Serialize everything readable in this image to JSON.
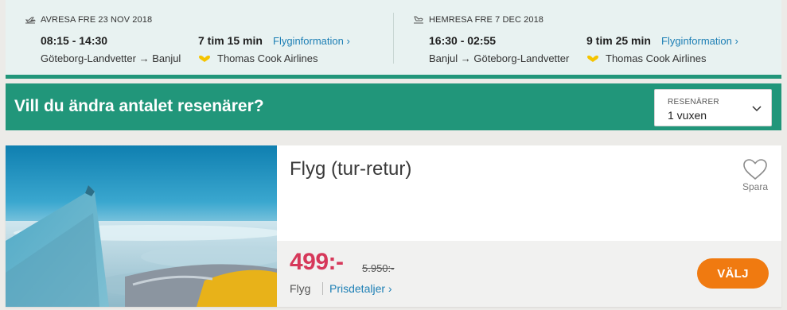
{
  "outbound": {
    "header": "AVRESA FRE 23 NOV 2018",
    "times": "08:15 - 14:30",
    "route": "Göteborg-Landvetter → Banjul",
    "duration": "7 tim 15 min",
    "info_link": "Flyginformation ›",
    "airline": "Thomas Cook Airlines"
  },
  "return": {
    "header": "HEMRESA FRE 7 DEC 2018",
    "times": "16:30 - 02:55",
    "route": "Banjul → Göteborg-Landvetter",
    "duration": "9 tim 25 min",
    "info_link": "Flyginformation ›",
    "airline": "Thomas Cook Airlines"
  },
  "travelers_banner": {
    "title": "Vill du ändra antalet resenärer?",
    "select_label": "RESENÄRER",
    "select_value": "1 vuxen"
  },
  "offer": {
    "title": "Flyg (tur-retur)",
    "save_label": "Spara",
    "price": "499:-",
    "old_price": "5.950:-",
    "price_type": "Flyg",
    "price_details": "Prisdetaljer ›",
    "choose_label": "VÄLJ"
  },
  "colors": {
    "accent_green": "#21967a",
    "price_red": "#d6385a",
    "button_orange": "#f07a10",
    "link_blue": "#1d7fb5"
  },
  "icons": {
    "departure": "plane-takeoff-icon",
    "arrival": "plane-landing-icon",
    "airline": "thomas-cook-logo",
    "save": "heart-icon",
    "select": "chevron-down-icon"
  }
}
